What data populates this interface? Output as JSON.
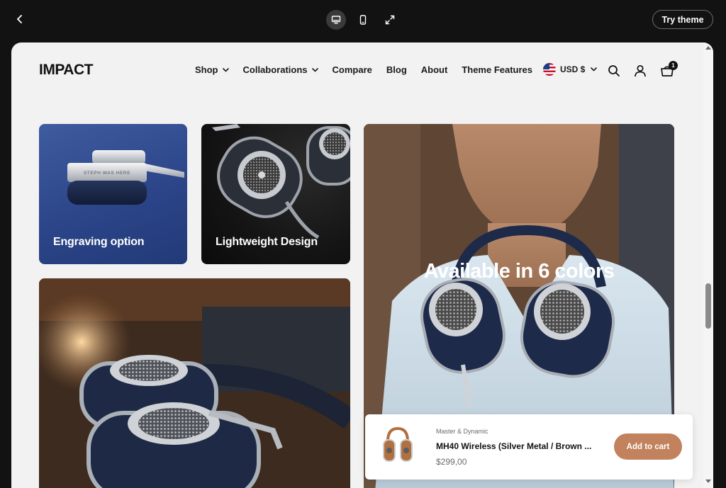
{
  "preview_bar": {
    "back_icon": "chevron-left-icon",
    "devices": [
      {
        "name": "desktop",
        "icon": "desktop-icon",
        "active": true
      },
      {
        "name": "mobile",
        "icon": "mobile-icon",
        "active": false
      },
      {
        "name": "fullscreen",
        "icon": "expand-icon",
        "active": false
      }
    ],
    "try_theme_label": "Try theme"
  },
  "store": {
    "logo": "IMPACT",
    "nav": [
      {
        "label": "Shop",
        "dropdown": true
      },
      {
        "label": "Collaborations",
        "dropdown": true
      },
      {
        "label": "Compare",
        "dropdown": false
      },
      {
        "label": "Blog",
        "dropdown": false
      },
      {
        "label": "About",
        "dropdown": false
      },
      {
        "label": "Theme Features",
        "dropdown": false
      }
    ],
    "currency": {
      "label": "USD $",
      "flag": "us-flag-icon"
    },
    "icons": {
      "search": "search-icon",
      "account": "user-icon",
      "cart": "cart-icon"
    },
    "cart_count": "1"
  },
  "tiles": {
    "engraving": {
      "caption": "Engraving option",
      "engraving_text": "STEPH WAS HERE"
    },
    "lightweight": {
      "caption": "Lightweight Design"
    },
    "colors": {
      "title": "Available in 6 colors"
    },
    "lifestyle": {}
  },
  "product_bar": {
    "vendor": "Master & Dynamic",
    "title": "MH40 Wireless (Silver Metal / Brown ...",
    "price": "$299,00",
    "add_to_cart_label": "Add to cart"
  },
  "colors": {
    "accent": "#c1825d",
    "background": "#121212",
    "page": "#f2f2f2"
  }
}
